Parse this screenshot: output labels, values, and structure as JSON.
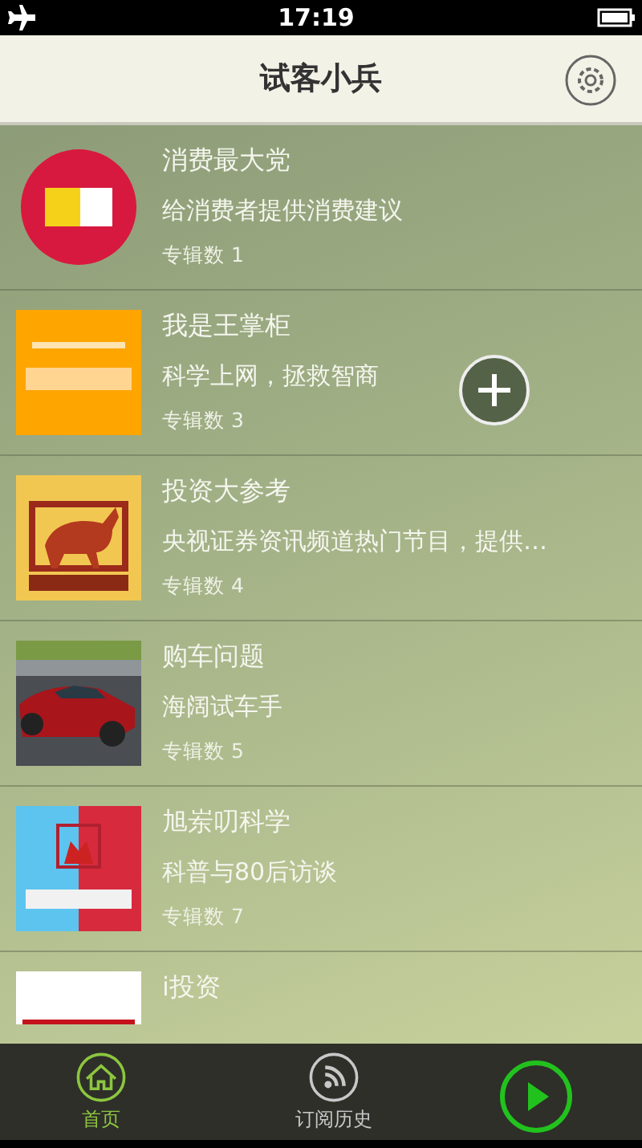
{
  "status_bar": {
    "time": "17:19"
  },
  "header": {
    "title": "试客小兵"
  },
  "items": [
    {
      "title": "消费最大党",
      "subtitle": "给消费者提供消费建议",
      "count": "专辑数 1",
      "kind": "circle"
    },
    {
      "title": "我是王掌柜",
      "subtitle": "科学上网，拯救智商",
      "count": "专辑数 3",
      "kind": "square"
    },
    {
      "title": "投资大参考",
      "subtitle": "央视证券资讯频道热门节目，提供…",
      "count": "专辑数 4",
      "kind": "square"
    },
    {
      "title": "购车问题",
      "subtitle": "海阔试车手",
      "count": "专辑数 5",
      "kind": "square"
    },
    {
      "title": "旭岽叨科学",
      "subtitle": "科普与80后访谈",
      "count": "专辑数 7",
      "kind": "square"
    },
    {
      "title": "i投资",
      "kind": "square"
    }
  ],
  "tabs": [
    {
      "label": "首页",
      "selected": true
    },
    {
      "label": "订阅历史",
      "selected": false
    }
  ]
}
